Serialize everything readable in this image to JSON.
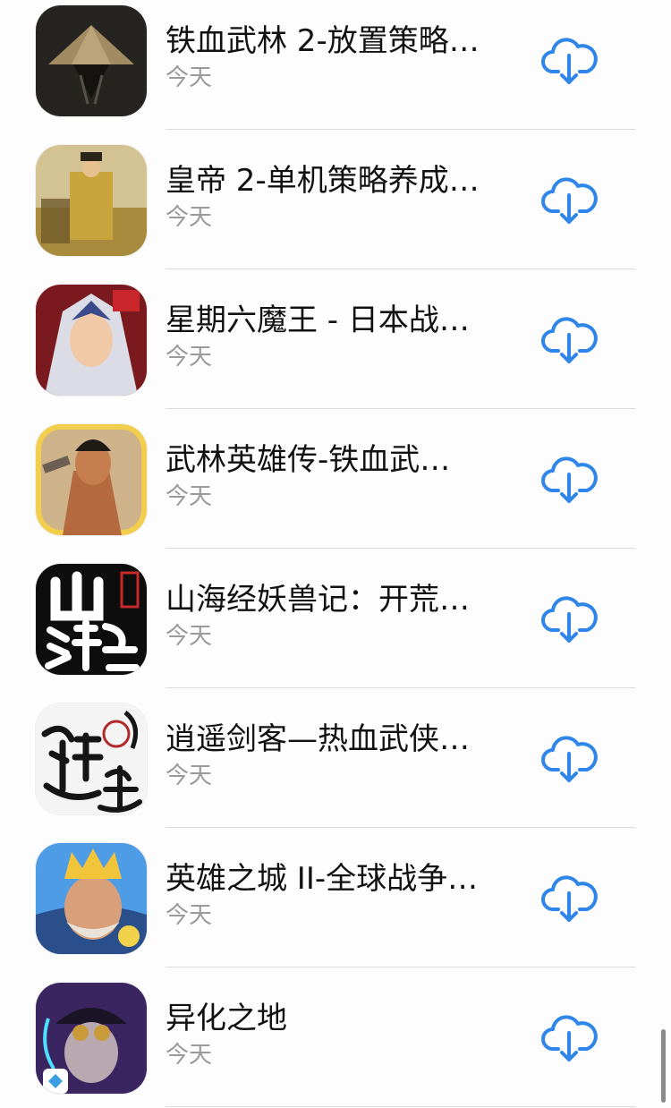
{
  "apps": [
    {
      "name": "铁血武林 2-放置策略…",
      "date": "今天"
    },
    {
      "name": "皇帝 2-单机策略养成…",
      "date": "今天"
    },
    {
      "name": "星期六魔王 - 日本战…",
      "date": "今天"
    },
    {
      "name": "武林英雄传-铁血武…",
      "date": "今天"
    },
    {
      "name": "山海经妖兽记：开荒…",
      "date": "今天"
    },
    {
      "name": "逍遥剑客—热血武侠…",
      "date": "今天"
    },
    {
      "name": "英雄之城 II-全球战争…",
      "date": "今天"
    },
    {
      "name": "异化之地",
      "date": "今天"
    }
  ],
  "icons": {
    "download": "cloud-download-icon"
  },
  "colors": {
    "accent": "#2f86e8",
    "subtitle": "#9a9a9a"
  }
}
